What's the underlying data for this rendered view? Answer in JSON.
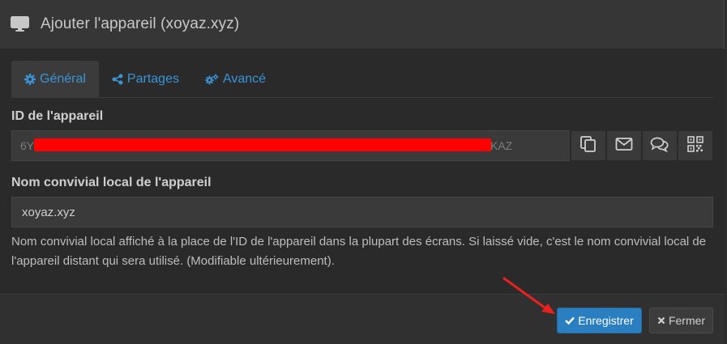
{
  "header": {
    "title": "Ajouter l'appareil (xoyaz.xyz)",
    "icon": "desktop-icon"
  },
  "tabs": [
    {
      "label": "Général",
      "icon": "gear-icon",
      "active": true
    },
    {
      "label": "Partages",
      "icon": "share-icon",
      "active": false
    },
    {
      "label": "Avancé",
      "icon": "gears-icon",
      "active": false
    }
  ],
  "device_id": {
    "label": "ID de l'appareil",
    "prefix": "6Y",
    "suffix": "KAZ",
    "redacted": true,
    "actions": [
      "copy-icon",
      "email-icon",
      "chat-icon",
      "qrcode-icon"
    ]
  },
  "device_name": {
    "label": "Nom convivial local de l'appareil",
    "value": "xoyaz.xyz",
    "help": "Nom convivial local affiché à la place de l'ID de l'appareil dans la plupart des écrans. Si laissé vide, c'est le nom convivial local de l'appareil distant qui sera utilisé. (Modifiable ultérieurement)."
  },
  "footer": {
    "save_label": "Enregistrer",
    "close_label": "Fermer"
  },
  "colors": {
    "accent": "#3a94d6",
    "primary_button": "#2a7fc1",
    "redaction": "#ff0000",
    "annotation_arrow": "#e8201e"
  }
}
